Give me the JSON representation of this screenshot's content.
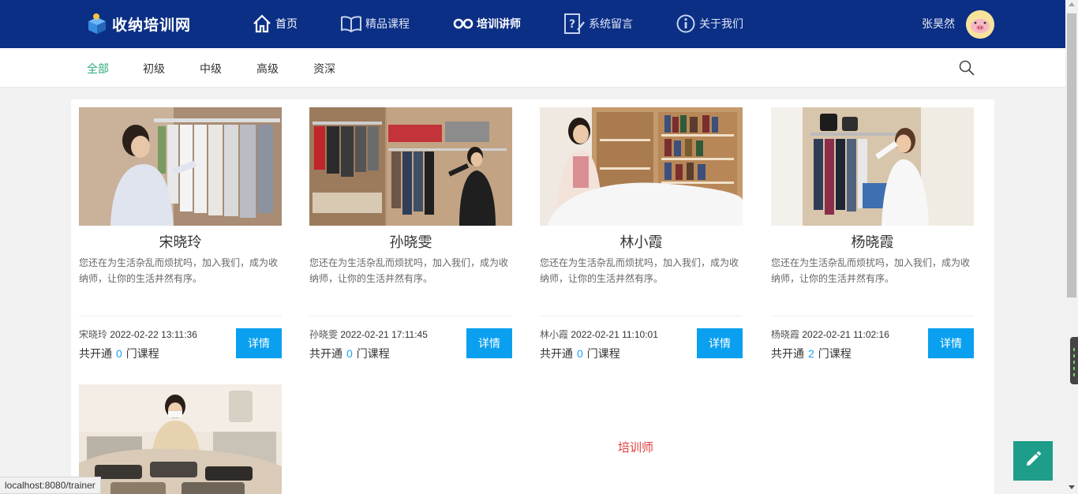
{
  "brand": {
    "logo_text": "收纳培训网"
  },
  "nav": [
    {
      "label": "首页",
      "icon": "home-icon"
    },
    {
      "label": "精品课程",
      "icon": "book-icon"
    },
    {
      "label": "培训讲师",
      "icon": "glasses-icon"
    },
    {
      "label": "系统留言",
      "icon": "message-icon"
    },
    {
      "label": "关于我们",
      "icon": "info-icon"
    }
  ],
  "user": {
    "name": "张昊然"
  },
  "categories": [
    "全部",
    "初级",
    "中级",
    "高级",
    "资深"
  ],
  "active_category": "全部",
  "trainers": [
    {
      "name": "宋晓玲",
      "desc": "您还在为生活杂乱而烦扰吗，加入我们，成为收纳师，让你的生活井然有序。",
      "author": "宋晓玲",
      "time": "2022-02-22 13:11:36",
      "count_prefix": "共开通",
      "count": "0",
      "count_suffix": "门课程",
      "button": "详情"
    },
    {
      "name": "孙晓雯",
      "desc": "您还在为生活杂乱而烦扰吗，加入我们，成为收纳师，让你的生活井然有序。",
      "author": "孙晓雯",
      "time": "2022-02-21 17:11:45",
      "count_prefix": "共开通",
      "count": "0",
      "count_suffix": "门课程",
      "button": "详情"
    },
    {
      "name": "林小霞",
      "desc": "您还在为生活杂乱而烦扰吗，加入我们，成为收纳师，让你的生活井然有序。",
      "author": "林小霞",
      "time": "2022-02-21 11:10:01",
      "count_prefix": "共开通",
      "count": "0",
      "count_suffix": "门课程",
      "button": "详情"
    },
    {
      "name": "杨晓霞",
      "desc": "您还在为生活杂乱而烦扰吗，加入我们，成为收纳师，让你的生活井然有序。",
      "author": "杨晓霞",
      "time": "2022-02-21 11:02:16",
      "count_prefix": "共开通",
      "count": "2",
      "count_suffix": "门课程",
      "button": "详情"
    }
  ],
  "role_label": "培训师",
  "status_url": "localhost:8080/trainer",
  "colors": {
    "header": "#0b2f85",
    "accent": "#2bab7a",
    "button": "#0aa0ef",
    "role": "#e23b3b",
    "fab": "#1e9e8a"
  }
}
